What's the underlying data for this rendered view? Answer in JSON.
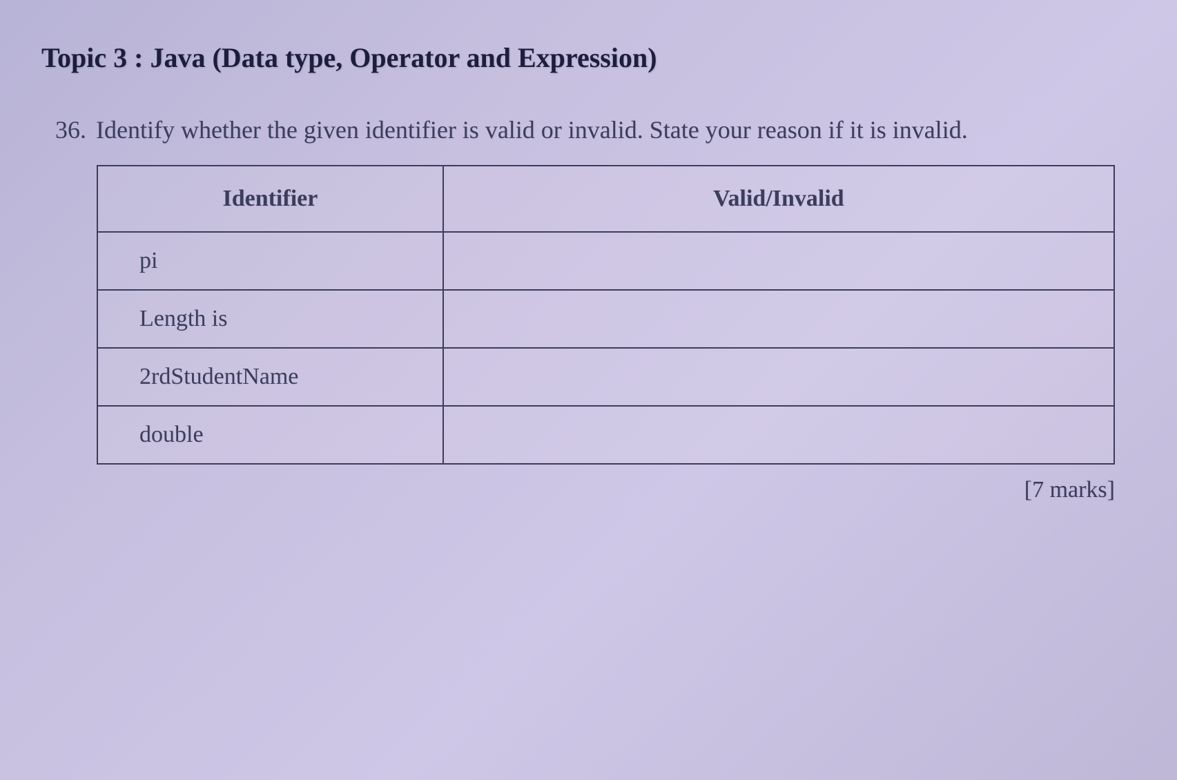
{
  "topic": {
    "heading": "Topic 3 : Java (Data type, Operator and Expression)"
  },
  "question": {
    "number": "36.",
    "text": "Identify whether the given identifier is valid or invalid. State your reason if it is invalid."
  },
  "table": {
    "headers": {
      "identifier": "Identifier",
      "validity": "Valid/Invalid"
    },
    "rows": [
      {
        "identifier": "pi",
        "validity": ""
      },
      {
        "identifier": "Length is",
        "validity": ""
      },
      {
        "identifier": "2rdStudentName",
        "validity": ""
      },
      {
        "identifier": "double",
        "validity": ""
      }
    ]
  },
  "marks": "[7 marks]"
}
